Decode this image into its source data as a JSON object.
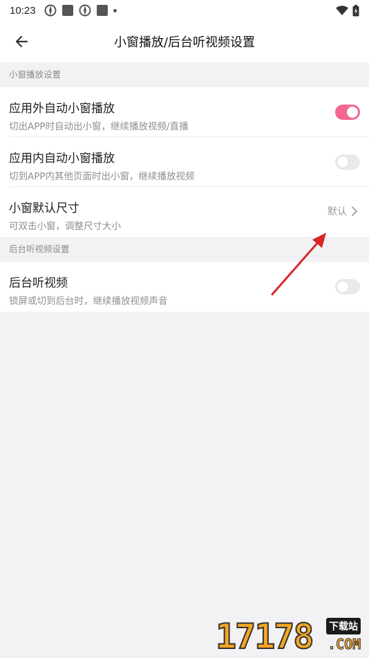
{
  "status_bar": {
    "time": "10:23",
    "left_icons": [
      "notification-icon",
      "square-icon",
      "notification-icon",
      "square-icon",
      "dot-icon"
    ],
    "right_icons": [
      "wifi-icon",
      "battery-icon"
    ]
  },
  "app_bar": {
    "title": "小窗播放/后台听视频设置",
    "back_icon": "arrow-left-icon"
  },
  "sections": [
    {
      "header": "小窗播放设置",
      "items": [
        {
          "title": "应用外自动小窗播放",
          "subtitle": "切出APP时自动出小窗，继续播放视频/直播",
          "control": "toggle",
          "on": true
        },
        {
          "title": "应用内自动小窗播放",
          "subtitle": "切到APP内其他页面时出小窗，继续播放视频",
          "control": "toggle",
          "on": false
        },
        {
          "title": "小窗默认尺寸",
          "subtitle": "可双击小窗，调整尺寸大小",
          "control": "value",
          "value": "默认"
        }
      ]
    },
    {
      "header": "后台听视频设置",
      "items": [
        {
          "title": "后台听视频",
          "subtitle": "锁屏或切到后台时，继续播放视频声音",
          "control": "toggle",
          "on": false
        }
      ]
    }
  ],
  "colors": {
    "accent": "#f2668f",
    "annotation_arrow": "#d8262b",
    "background": "#f2f2f4"
  },
  "watermark": {
    "number": "17178",
    "badge": "下载站",
    "suffix": ".COM"
  }
}
